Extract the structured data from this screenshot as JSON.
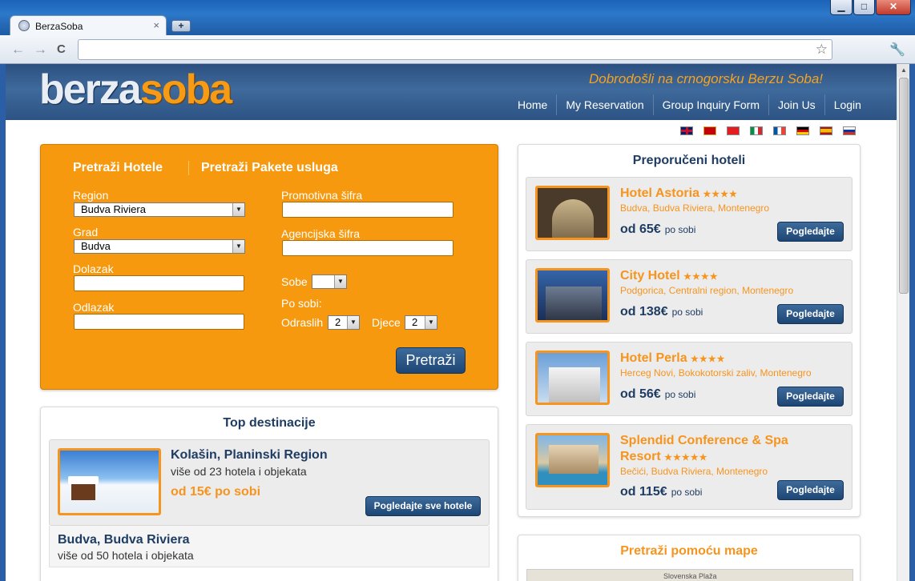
{
  "browser": {
    "tab_title": "BerzaSoba",
    "tab_close": "×",
    "new_tab": "+",
    "address": "",
    "window_controls": {
      "minimize": "▁",
      "maximize": "□",
      "close": "✕"
    },
    "nav_icons": {
      "back": "←",
      "forward": "→",
      "reload": "C",
      "star": "☆",
      "wrench": "🔧"
    }
  },
  "site": {
    "logo": {
      "part1": "berza",
      "part2": "soba"
    },
    "welcome": "Dobrodošli na crnogorsku Berzu Soba!",
    "nav": [
      "Home",
      "My Reservation",
      "Group Inquiry Form",
      "Join Us",
      "Login"
    ],
    "flags": [
      "gb",
      "me",
      "al",
      "it",
      "fr",
      "de",
      "es",
      "ru"
    ]
  },
  "search": {
    "tab_hotels": "Pretraži Hotele",
    "tab_packages": "Pretraži Pakete usluga",
    "region_label": "Region",
    "region_value": "Budva Riviera",
    "city_label": "Grad",
    "city_value": "Budva",
    "arrival_label": "Dolazak",
    "arrival_value": "",
    "departure_label": "Odlazak",
    "departure_value": "",
    "promo_label": "Promotivna šifra",
    "promo_value": "",
    "agency_label": "Agencijska šifra",
    "agency_value": "",
    "rooms_label": "Sobe",
    "rooms_value": "",
    "per_room_label": "Po sobi:",
    "adults_label": "Odraslih",
    "adults_value": "2",
    "children_label": "Djece",
    "children_value": "2",
    "submit": "Pretraži"
  },
  "top_destinations": {
    "title": "Top destinacije",
    "items": [
      {
        "name": "Kolašin, Planinski Region",
        "sub": "više od 23 hotela i objekata",
        "price": "od 15€ po sobi",
        "button": "Pogledajte sve hotele"
      },
      {
        "name": "Budva, Budva Riviera",
        "sub": "više od 50 hotela i objekata"
      }
    ]
  },
  "recommended": {
    "title": "Preporučeni hoteli",
    "button_label": "Pogledajte",
    "per_room": "po sobi",
    "hotels": [
      {
        "name": "Hotel Astoria",
        "stars": "★★★★",
        "location": "Budva, Budva Riviera, Montenegro",
        "price": "od 65€"
      },
      {
        "name": "City Hotel",
        "stars": "★★★★",
        "location": "Podgorica, Centralni region, Montenegro",
        "price": "od 138€"
      },
      {
        "name": "Hotel Perla",
        "stars": "★★★★",
        "location": "Herceg Novi, Bokokotorski zaliv, Montenegro",
        "price": "od 56€"
      },
      {
        "name": "Splendid Conference & Spa Resort",
        "stars": "★★★★★",
        "location": "Bečići, Budva Riviera, Montenegro",
        "price": "od 115€"
      }
    ]
  },
  "map_search": {
    "title": "Pretraži pomoću mape",
    "map_label": "Slovenska Plaža"
  }
}
